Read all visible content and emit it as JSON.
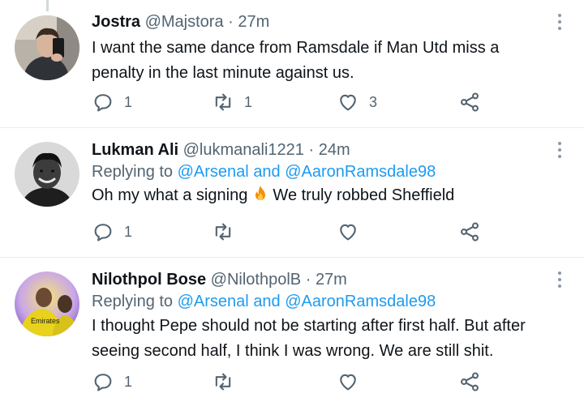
{
  "tweets": [
    {
      "name": "Jostra",
      "handle": "@Majstora",
      "separator": "·",
      "time": "27m",
      "replying": null,
      "text_lines": [
        "I want the same dance from Ramsdale if Man Utd miss a",
        "penalty in the last minute against us."
      ],
      "reply_count": "1",
      "retweet_count": "1",
      "like_count": "3"
    },
    {
      "name": "Lukman Ali",
      "handle": "@lukmanali1221",
      "separator": "·",
      "time": "24m",
      "replying": {
        "prefix": "Replying to",
        "mention1": "@Arsenal",
        "and": "and",
        "mention2": "@AaronRamsdale98"
      },
      "text_before": "Oh my what a signing ",
      "text_after": " We truly robbed Sheffield",
      "reply_count": "1",
      "retweet_count": "",
      "like_count": ""
    },
    {
      "name": "Nilothpol Bose",
      "handle": "@NilothpolB",
      "separator": "·",
      "time": "27m",
      "replying": {
        "prefix": "Replying to",
        "mention1": "@Arsenal",
        "and": "and",
        "mention2": "@AaronRamsdale98"
      },
      "text_lines": [
        "I thought Pepe should not be starting after first half. But after",
        "seeing second half, I think I was wrong. We are still shit."
      ],
      "reply_count": "1",
      "retweet_count": "",
      "like_count": ""
    }
  ],
  "avatar3_text": "Emirates",
  "icons": {
    "reply": "reply-icon",
    "retweet": "retweet-icon",
    "like": "heart-icon",
    "share": "share-icon",
    "more": "more-options-icon"
  },
  "colors": {
    "link": "#1d9bf0",
    "secondary": "#536471",
    "divider": "#e6ecf0"
  }
}
